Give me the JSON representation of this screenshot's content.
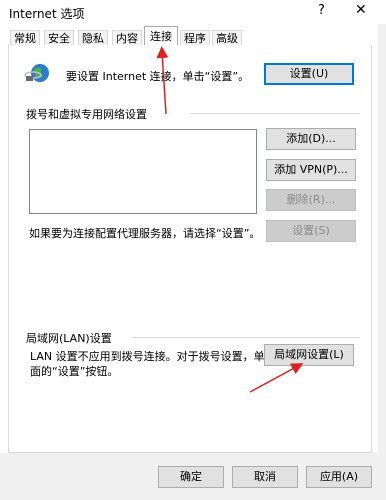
{
  "window": {
    "title": "Internet 选项",
    "help": "?",
    "close": "✕"
  },
  "tabs": [
    {
      "label": "常规"
    },
    {
      "label": "安全"
    },
    {
      "label": "隐私"
    },
    {
      "label": "内容"
    },
    {
      "label": "连接"
    },
    {
      "label": "程序"
    },
    {
      "label": "高级"
    }
  ],
  "setup": {
    "text": "要设置 Internet 连接，单击“设置”。",
    "button": "设置(U)"
  },
  "dialup": {
    "heading": "拨号和虚拟专用网络设置",
    "add": "添加(D)...",
    "add_vpn": "添加 VPN(P)...",
    "delete": "删除(R)...",
    "proxy_text": "如果要为连接配置代理服务器，请选择“设置”。",
    "settings": "设置(S)"
  },
  "lan": {
    "heading": "局域网(LAN)设置",
    "text_line1": "LAN 设置不应用到拨号连接。对于拨号设置，单击上",
    "text_line2": "面的“设置”按钮。",
    "button": "局域网设置(L)"
  },
  "footer": {
    "ok": "确定",
    "cancel": "取消",
    "apply": "应用(A)"
  },
  "colors": {
    "focus_border": "#0078d7",
    "arrow": "#e02020",
    "globe": "#2a7bd1"
  }
}
